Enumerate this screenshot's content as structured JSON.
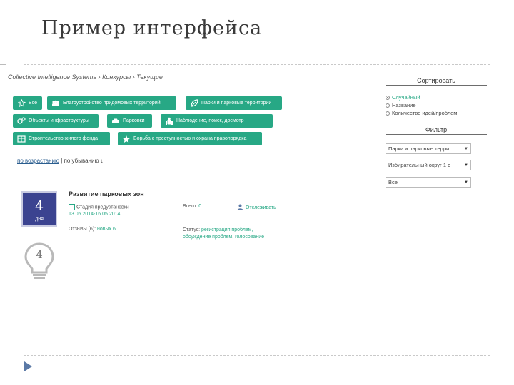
{
  "slide": {
    "title": "Пример интерфейса"
  },
  "breadcrumb": {
    "root": "Collective Intelligence Systems",
    "sep1": " › ",
    "contests": "Конкурсы",
    "sep2": " › ",
    "current": "Текущие"
  },
  "categories": [
    {
      "label": "Все",
      "icon": "star-outline-icon"
    },
    {
      "label": "Благоустройство придомовых территорий",
      "icon": "people-icon"
    },
    {
      "label": "Парки и парковые территории",
      "icon": "leaf-icon"
    },
    {
      "label": "Объекты инфраструктуры",
      "icon": "gears-icon"
    },
    {
      "label": "Парковки",
      "icon": "car-icon"
    },
    {
      "label": "Наблюдение, поиск, досмотр",
      "icon": "people-group-icon"
    },
    {
      "label": "Строительство жилого фонда",
      "icon": "building-icon"
    },
    {
      "label": "Борьба с преступностью и охрана правопорядка",
      "icon": "star-icon"
    }
  ],
  "sort_links": {
    "asc": "по возрастанию",
    "sep": " | ",
    "desc": "по убыванию ↓"
  },
  "card": {
    "days_number": "4",
    "days_label": "дня",
    "bulb_number": "4",
    "title": "Развитие парковых зон",
    "stage_label": "Стадия предустановки",
    "stage_dates": "13.05.2014-16.05.2014",
    "reviews_label": "Отзывы (6):",
    "reviews_new": "новых 6",
    "ideas_label": "Всего:",
    "ideas_value": "0",
    "track_label": "Отслеживать",
    "status_label": "Статус:",
    "status_value_1": "регистрация проблем,",
    "status_value_2": "обсуждение проблем, голосование"
  },
  "sort_panel": {
    "title": "Сортировать",
    "options": [
      {
        "label": "Случайный",
        "selected": true
      },
      {
        "label": "Название",
        "selected": false
      },
      {
        "label": "Количество идей/проблем",
        "selected": false
      }
    ]
  },
  "filter_panel": {
    "title": "Фильтр",
    "selects": [
      "Парки и парковые терри",
      "Избирательный округ 1 с",
      "Все"
    ]
  },
  "colors": {
    "accent": "#27a885",
    "days_box": "#3b4390",
    "nav_arrow": "#5b79a6"
  }
}
